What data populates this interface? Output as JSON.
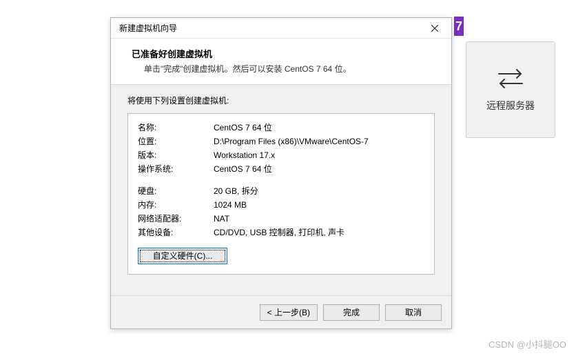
{
  "background": {
    "remote_label": "远程服务器",
    "purple_tag": "7"
  },
  "dialog": {
    "title": "新建虚拟机向导",
    "header": {
      "heading": "已准备好创建虚拟机",
      "subtitle": "单击\"完成\"创建虚拟机。然后可以安装 CentOS 7 64 位。"
    },
    "intro": "将使用下列设置创建虚拟机:",
    "settings_group1": [
      {
        "key": "名称:",
        "val": "CentOS 7 64 位"
      },
      {
        "key": "位置:",
        "val": "D:\\Program Files (x86)\\VMware\\CentOS-7"
      },
      {
        "key": "版本:",
        "val": "Workstation 17.x"
      },
      {
        "key": "操作系统:",
        "val": "CentOS 7 64 位"
      }
    ],
    "settings_group2": [
      {
        "key": "硬盘:",
        "val": "20 GB, 拆分"
      },
      {
        "key": "内存:",
        "val": "1024 MB"
      },
      {
        "key": "网络适配器:",
        "val": "NAT"
      },
      {
        "key": "其他设备:",
        "val": "CD/DVD, USB 控制器, 打印机, 声卡"
      }
    ],
    "customize_label": "自定义硬件(C)...",
    "footer": {
      "back": "< 上一步(B)",
      "finish": "完成",
      "cancel": "取消"
    }
  },
  "watermark": "CSDN @小抖腿OO"
}
